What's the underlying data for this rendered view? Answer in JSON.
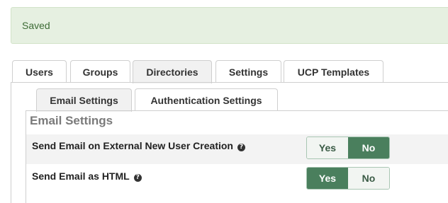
{
  "alert": {
    "text": "Saved"
  },
  "main_tabs": [
    {
      "label": "Users"
    },
    {
      "label": "Groups"
    },
    {
      "label": "Directories"
    },
    {
      "label": "Settings",
      "active": true
    },
    {
      "label": "UCP Templates"
    }
  ],
  "sub_tabs": [
    {
      "label": "Email Settings",
      "active": true
    },
    {
      "label": "Authentication Settings"
    }
  ],
  "section": {
    "title": "Email Settings"
  },
  "settings": [
    {
      "label": "Send Email on External New User Creation",
      "help_icon": "question-circle",
      "yes_label": "Yes",
      "no_label": "No",
      "value": "No"
    },
    {
      "label": "Send Email as HTML",
      "help_icon": "question-circle",
      "yes_label": "Yes",
      "no_label": "No",
      "value": "Yes"
    }
  ],
  "colors": {
    "alert_bg": "#e6f0e1",
    "alert_text": "#3d6b35",
    "toggle_active": "#4a7f5d"
  }
}
